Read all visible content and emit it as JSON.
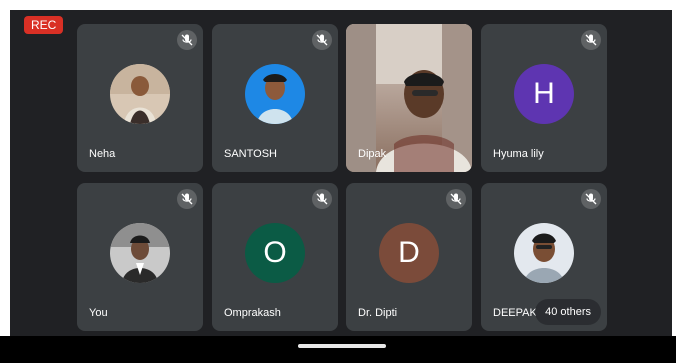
{
  "meeting": {
    "rec_label": "REC",
    "others_label": "40 others"
  },
  "participants": [
    {
      "name": "Neha",
      "muted": true,
      "kind": "photo"
    },
    {
      "name": "SANTOSH",
      "muted": true,
      "kind": "photo"
    },
    {
      "name": "Dipak",
      "muted": false,
      "kind": "video"
    },
    {
      "name": "Hyuma lily",
      "muted": true,
      "kind": "letter",
      "letter": "H",
      "color": "#5e35b1"
    },
    {
      "name": "You",
      "muted": true,
      "kind": "photo"
    },
    {
      "name": "Omprakash",
      "muted": true,
      "kind": "letter",
      "letter": "O",
      "color": "#0b5b45"
    },
    {
      "name": "Dr. Dipti",
      "muted": true,
      "kind": "letter",
      "letter": "D",
      "color": "#7b4b3a"
    },
    {
      "name": "DEEPAK",
      "muted": true,
      "kind": "photo"
    }
  ],
  "colors": {
    "background": "#202124",
    "tile": "#3c4043",
    "rec": "#d93025"
  }
}
